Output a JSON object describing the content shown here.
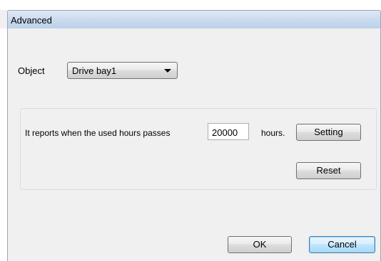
{
  "window": {
    "title": "Advanced"
  },
  "object": {
    "label": "Object",
    "selected": "Drive bay1"
  },
  "group": {
    "report_label": "It reports when the used hours passes",
    "hours_value": "20000",
    "hours_unit": "hours.",
    "setting_label": "Setting",
    "reset_label": "Reset"
  },
  "footer": {
    "ok_label": "OK",
    "cancel_label": "Cancel"
  },
  "icons": {
    "combo_arrow": "chevron-down-icon"
  },
  "colors": {
    "titlebar": "#c9daee",
    "default_button_border": "#3c7fb1",
    "default_button_fill": "#bee6fd",
    "dialog_background": "#f0f0f0"
  }
}
